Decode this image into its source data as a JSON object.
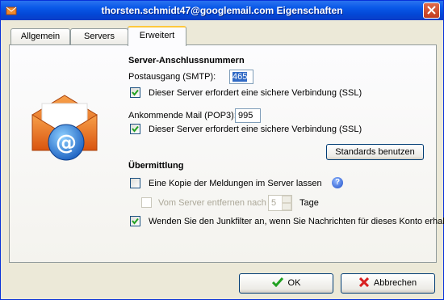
{
  "window": {
    "title": "thorsten.schmidt47@googlemail.com Eigenschaften",
    "icon": "envelope-icon"
  },
  "tabs": [
    {
      "label": "Allgemein",
      "active": false
    },
    {
      "label": "Servers",
      "active": false
    },
    {
      "label": "Erweitert",
      "active": true
    }
  ],
  "server_ports": {
    "heading": "Server-Anschlussnummern",
    "smtp_label": "Postausgang (SMTP):",
    "smtp_value": "465",
    "smtp_ssl_label": "Dieser Server erfordert eine sichere Verbindung (SSL)",
    "smtp_ssl_checked": true,
    "pop3_label": "Ankommende Mail (POP3):",
    "pop3_value": "995",
    "pop3_ssl_label": "Dieser Server erfordert eine sichere Verbindung (SSL)",
    "pop3_ssl_checked": true,
    "defaults_button": "Standards benutzen"
  },
  "delivery": {
    "heading": "Übermittlung",
    "keep_copy_label": "Eine Kopie der Meldungen im Server lassen",
    "keep_copy_checked": false,
    "remove_label": "Vom Server entfernen nach",
    "remove_checked": false,
    "remove_days": "5",
    "days_label": "Tage",
    "junk_label": "Wenden Sie den Junkfilter an, wenn Sie Nachrichten für dieses Konto erhalten",
    "junk_checked": true
  },
  "footer": {
    "ok_label": "OK",
    "cancel_label": "Abbrechen"
  },
  "colors": {
    "titlebar": "#0a59e8",
    "active_tab_accent": "#ffc83c",
    "check_green": "#21a121",
    "cancel_red": "#d82020",
    "envelope_orange": "#e8651a",
    "at_blue": "#2a7ad8"
  }
}
